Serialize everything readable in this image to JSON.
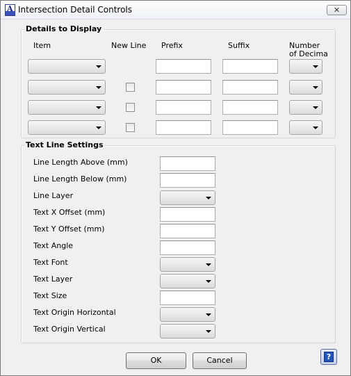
{
  "window": {
    "title": "Intersection Detail Controls",
    "close_glyph": "✕"
  },
  "details": {
    "title": "Details to Display",
    "headers": {
      "item": "Item",
      "new_line": "New Line",
      "prefix": "Prefix",
      "suffix": "Suffix",
      "decimals_line1": "Number",
      "decimals_line2": "of Decima"
    }
  },
  "text_line": {
    "title": "Text  Line Settings",
    "labels": {
      "line_length_above": "Line Length Above (mm)",
      "line_length_below": "Line Length Below (mm)",
      "line_layer": "Line Layer",
      "text_x_offset": "Text X Offset (mm)",
      "text_y_offset": "Text Y Offset (mm)",
      "text_angle": "Text Angle",
      "text_font": "Text Font",
      "text_layer": "Text Layer",
      "text_size": "Text Size",
      "text_origin_horizontal": "Text Origin Horizontal",
      "text_origin_vertical": "Text Origin Vertical"
    }
  },
  "buttons": {
    "ok": "OK",
    "cancel": "Cancel",
    "help": "?"
  }
}
